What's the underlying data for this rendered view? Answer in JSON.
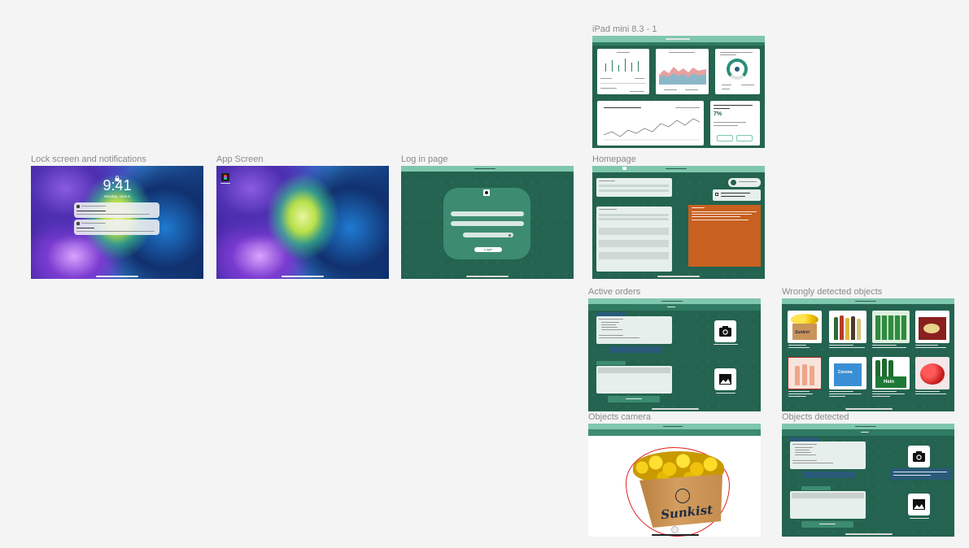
{
  "frames": {
    "ipad": "iPad mini 8.3 - 1",
    "lock": "Lock screen and notifications",
    "app": "App Screen",
    "login": "Log in page",
    "home": "Homepage",
    "active": "Active orders",
    "wrong": "Wrongly detected objects",
    "camera": "Objects camera",
    "detected": "Objects detected"
  },
  "lock": {
    "time": "9:41",
    "date": "Monday, June 6"
  },
  "login": {
    "button": "Login"
  },
  "ipad": {
    "big_value": "7%"
  },
  "camera": {
    "box_brand": "Sunkist"
  },
  "wrong": {
    "tile_brands": [
      "Sunkist",
      "Corona",
      "Hein"
    ]
  },
  "colors": {
    "app_green": "#23634f",
    "header_mint": "#7fc7ad",
    "alert_orange": "#c8601f",
    "pill_blue": "#2a5a7a"
  }
}
